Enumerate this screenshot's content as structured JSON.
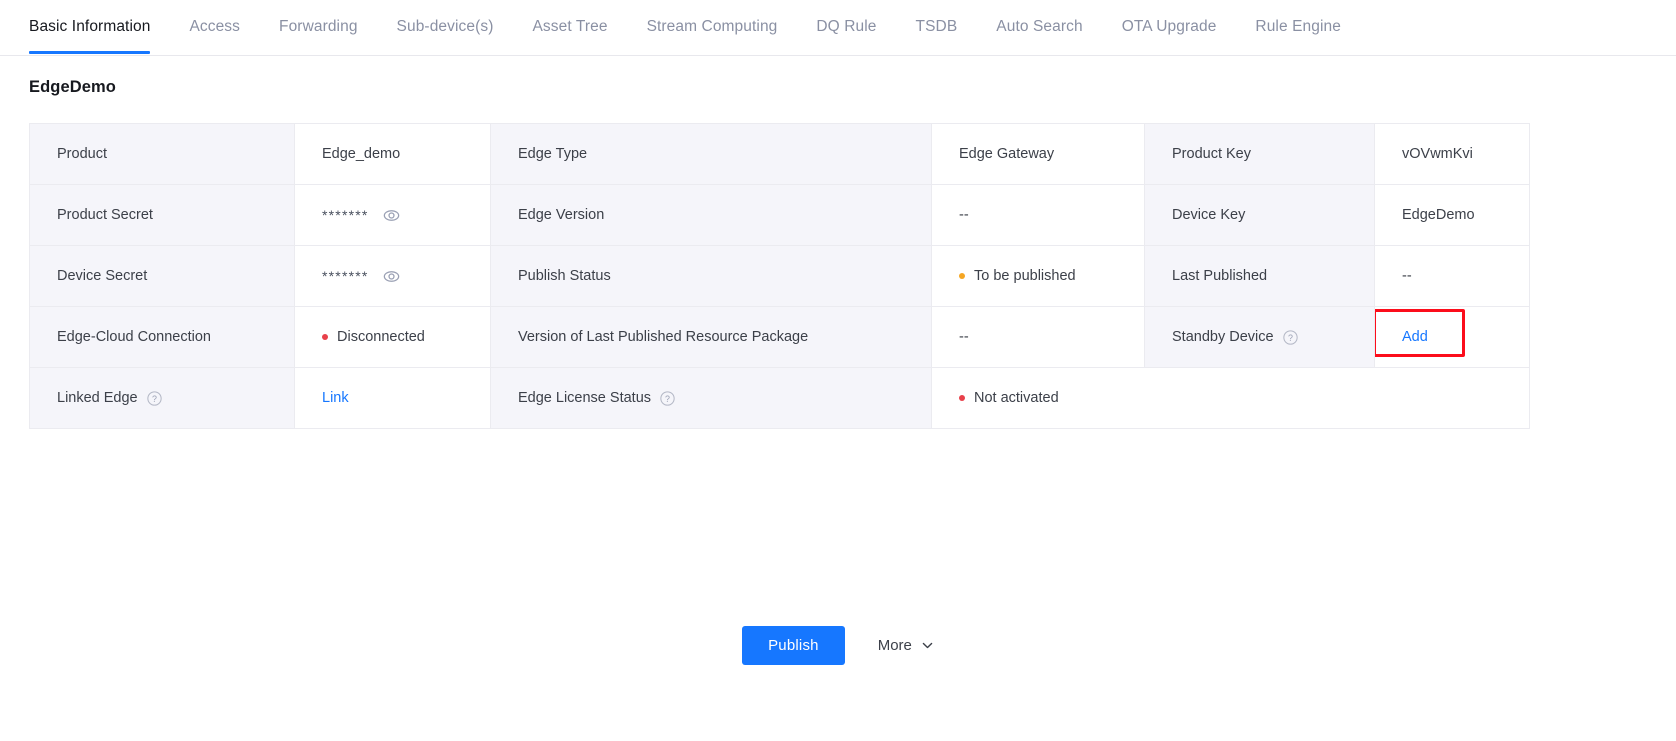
{
  "tabs": [
    {
      "label": "Basic Information",
      "active": true
    },
    {
      "label": "Access",
      "active": false
    },
    {
      "label": "Forwarding",
      "active": false
    },
    {
      "label": "Sub-device(s)",
      "active": false
    },
    {
      "label": "Asset Tree",
      "active": false
    },
    {
      "label": "Stream Computing",
      "active": false
    },
    {
      "label": "DQ Rule",
      "active": false
    },
    {
      "label": "TSDB",
      "active": false
    },
    {
      "label": "Auto Search",
      "active": false
    },
    {
      "label": "OTA Upgrade",
      "active": false
    },
    {
      "label": "Rule Engine",
      "active": false
    }
  ],
  "page": {
    "title": "EdgeDemo"
  },
  "table": {
    "rows": [
      {
        "label1": "Product",
        "value1": "Edge_demo",
        "label2": "Edge Type",
        "value2": "Edge Gateway",
        "label3": "Product Key",
        "value3": "vOVwmKvi"
      },
      {
        "label1": "Product Secret",
        "value1": "*******",
        "label2": "Edge Version",
        "value2": "--",
        "label3": "Device Key",
        "value3": "EdgeDemo"
      },
      {
        "label1": "Device Secret",
        "value1": "*******",
        "label2": "Publish Status",
        "value2": "To be published",
        "label3": "Last Published",
        "value3": "--"
      },
      {
        "label1": "Edge-Cloud Connection",
        "value1": "Disconnected",
        "label2": "Version of Last Published Resource Package",
        "value2": "--",
        "label3": "Standby Device",
        "value3": "Add"
      },
      {
        "label1": "Linked Edge",
        "value1": "Link",
        "label2": "Edge License Status",
        "value2": "Not activated"
      }
    ]
  },
  "icons": {
    "eye": "eye-icon",
    "help": "help-circle-icon",
    "chevron": "chevron-down-icon"
  },
  "footer": {
    "publish_label": "Publish",
    "more_label": "More"
  },
  "colors": {
    "accent": "#1677ff",
    "highlight": "#fc0d1b",
    "status_warning": "#f5a623",
    "status_error": "#e8404a",
    "label_bg": "#f5f5fa",
    "border": "#ebebf0"
  }
}
